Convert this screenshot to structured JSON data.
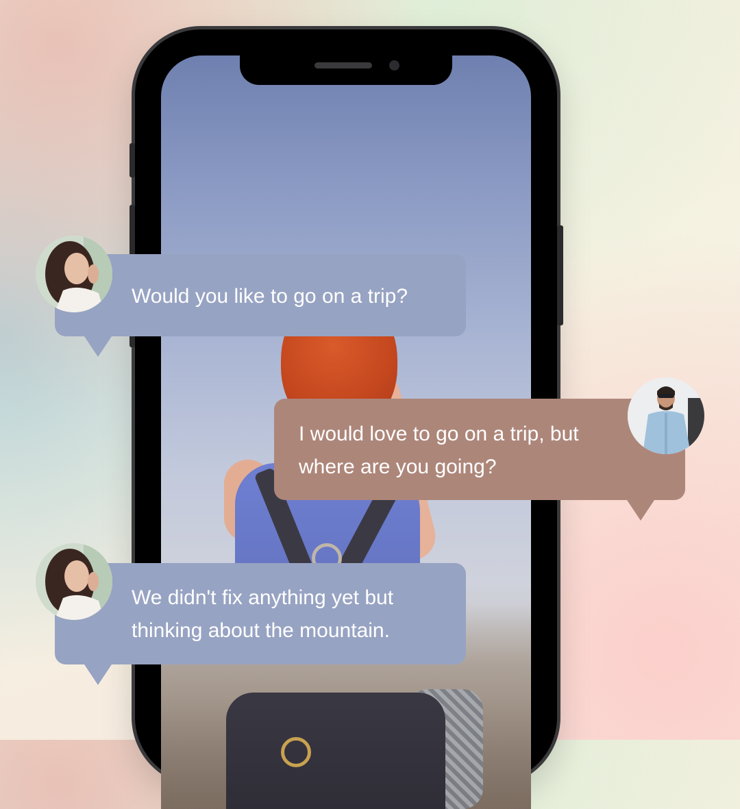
{
  "background": {
    "colors": [
      "#f1ecdc",
      "#e8bab0",
      "#b0ced6",
      "#fccecA"
    ]
  },
  "phone": {
    "frame_color": "#000000",
    "wallpaper": "woman-with-backpack-photo"
  },
  "chat": {
    "messages": [
      {
        "sender": "woman",
        "avatar": "woman-avatar",
        "bubble_color": "#97a3c2",
        "lines": [
          "Would you like to go on a trip?"
        ]
      },
      {
        "sender": "man",
        "avatar": "man-avatar",
        "bubble_color": "#ad867a",
        "lines": [
          "I would love to go on a trip, but",
          "where are you going?"
        ]
      },
      {
        "sender": "woman",
        "avatar": "woman-avatar",
        "bubble_color": "#97a3c2",
        "lines": [
          "We didn't fix anything yet but",
          "thinking about the mountain."
        ]
      }
    ]
  }
}
